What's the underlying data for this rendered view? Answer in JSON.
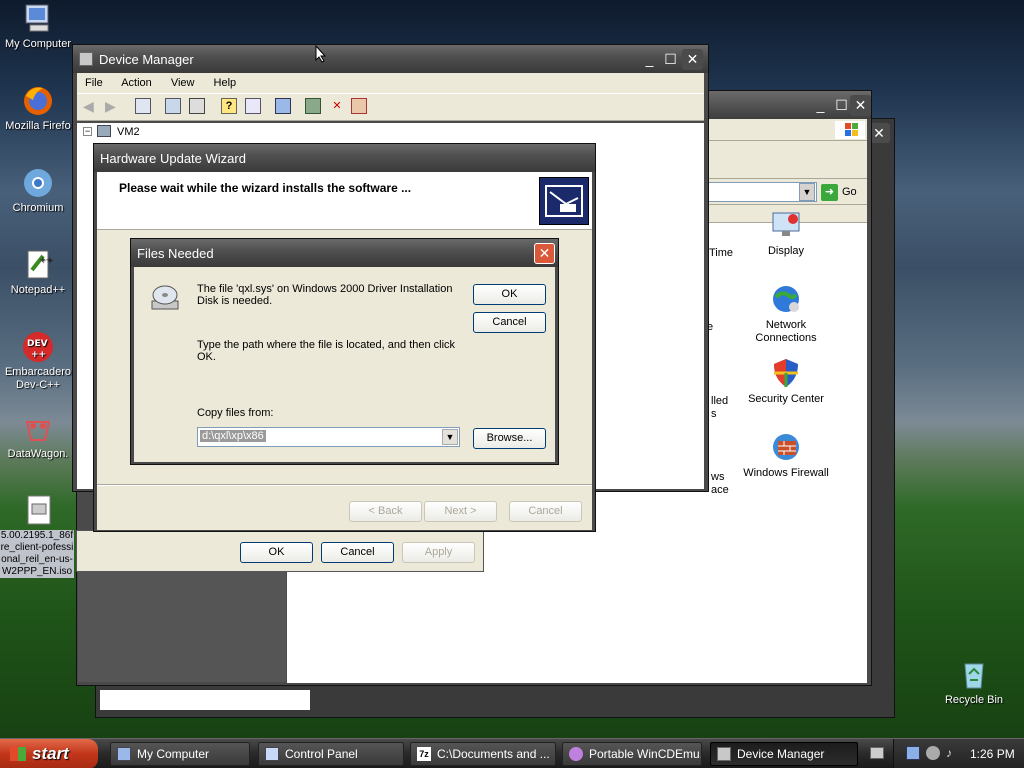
{
  "desktop": {
    "icons": [
      {
        "label": "My Computer"
      },
      {
        "label": "Mozilla Firefo"
      },
      {
        "label": "Chromium"
      },
      {
        "label": "Notepad++"
      },
      {
        "label": "Embarcadero Dev-C++"
      },
      {
        "label": "DataWagon."
      },
      {
        "label": "5.00.2195.1_86fre_client-pofessional_reil_en-us-W2PPP_EN.iso"
      },
      {
        "label": "Recycle Bin"
      }
    ]
  },
  "control_panel": {
    "go_label": "Go",
    "items": [
      "Time",
      "Display",
      "Network Connections",
      "Security Center",
      "Windows Firewall"
    ],
    "partial_labels": [
      "e",
      "lled",
      "s",
      "ws",
      "ace"
    ]
  },
  "device_manager": {
    "title": "Device Manager",
    "menu": [
      "File",
      "Action",
      "View",
      "Help"
    ],
    "tree_root": "VM2"
  },
  "properties_dialog": {
    "ok": "OK",
    "cancel": "Cancel",
    "apply": "Apply"
  },
  "wizard": {
    "title": "Hardware Update Wizard",
    "heading": "Please wait while the wizard installs the software ...",
    "back": "< Back",
    "next": "Next >",
    "cancel": "Cancel"
  },
  "files_needed": {
    "title": "Files Needed",
    "message": "The file 'qxl.sys' on Windows 2000 Driver Installation Disk is needed.",
    "instruction": "Type the path where the file is located, and then click OK.",
    "copy_label": "Copy files from:",
    "path_value": "d:\\qxl\\xp\\x86",
    "ok": "OK",
    "cancel": "Cancel",
    "browse": "Browse..."
  },
  "taskbar": {
    "start": "start",
    "tasks": [
      "My Computer",
      "Control Panel",
      "C:\\Documents and ...",
      "Portable WinCDEmu...",
      "Device Manager"
    ],
    "clock": "1:26 PM"
  },
  "colors": {
    "title_gray": "#4e4e4e",
    "close_red": "#d9593a",
    "dialog_bg": "#ece9d8",
    "start_red": "#c2361a"
  }
}
